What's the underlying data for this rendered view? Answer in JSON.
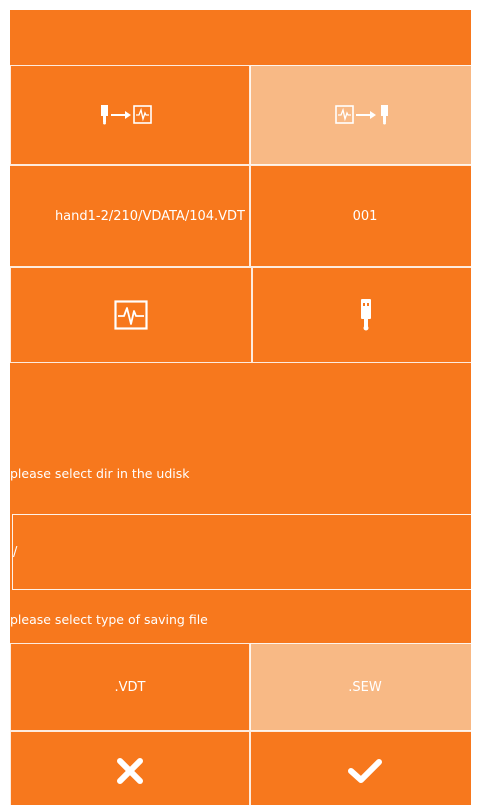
{
  "direction": {
    "to_device": {
      "icon": "usb-to-device-icon"
    },
    "to_usb": {
      "icon": "device-to-usb-icon"
    }
  },
  "path": {
    "file": "hand1-2/210/VDATA/104.VDT",
    "number": "001"
  },
  "sources": {
    "device": {
      "icon": "waveform-icon"
    },
    "usb": {
      "icon": "usb-drive-icon"
    }
  },
  "dir_prompt": "please select dir in the udisk",
  "dir_select": {
    "value": "/"
  },
  "type_prompt": "please select type of saving file",
  "file_types": {
    "vdt": ".VDT",
    "sew": ".SEW"
  },
  "actions": {
    "cancel_icon": "close-icon",
    "confirm_icon": "check-icon"
  },
  "colors": {
    "accent": "#f7781d",
    "selected": "#f8b985",
    "text": "#ffffff"
  }
}
